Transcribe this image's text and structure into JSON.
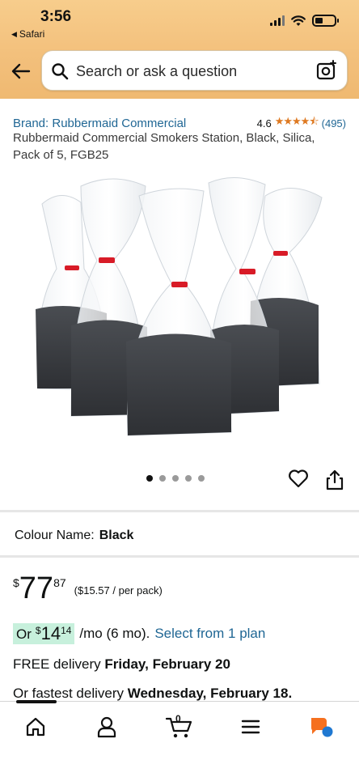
{
  "status_bar": {
    "time": "3:56",
    "back_app": "Safari"
  },
  "search": {
    "placeholder": "Search or ask a question"
  },
  "product": {
    "brand": "Brand: Rubbermaid Commercial",
    "rating_value": "4.6",
    "stars": "★★★★⯪",
    "review_count": "(495)",
    "title": "Rubbermaid Commercial Smokers Station, Black, Silica, Pack of 5, FGB25"
  },
  "gallery": {
    "image_count": 5,
    "active_index": 0
  },
  "colour": {
    "label": "Colour Name:",
    "value": "Black"
  },
  "price": {
    "symbol": "$",
    "whole": "77",
    "fraction": "87",
    "per_unit": "($15.57 / per pack)"
  },
  "finance": {
    "prefix": "Or",
    "symbol": "$",
    "amount": "14",
    "fraction": "14",
    "term": "/mo (6 mo).",
    "link": "Select from 1 plan"
  },
  "delivery": {
    "free_text": "FREE delivery",
    "free_date": "Friday, February 20",
    "fastest_text": "Or fastest delivery",
    "fastest_date": "Wednesday, February 18."
  },
  "tabbar": {
    "cart_count": "0",
    "active": "home"
  },
  "colors": {
    "header_bg": "#f3c07c",
    "link": "#1f6694",
    "star": "#de7921",
    "finance_highlight": "#c7f0dc"
  }
}
